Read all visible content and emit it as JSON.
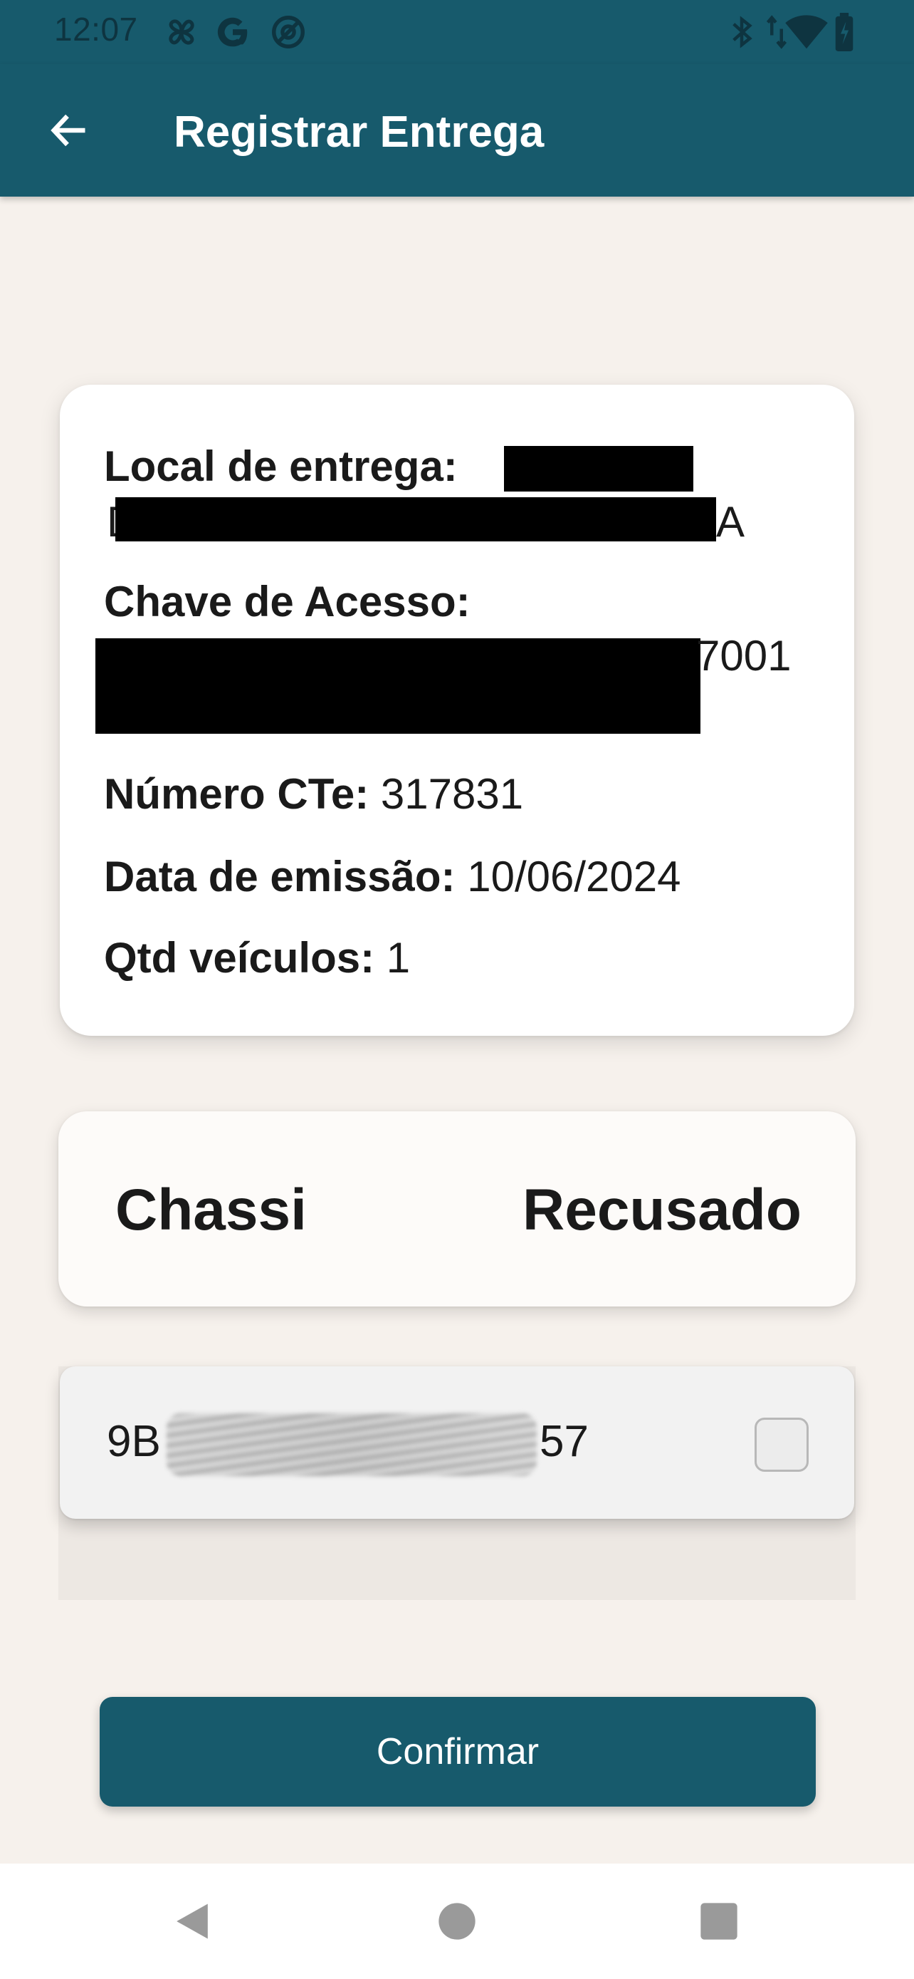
{
  "status_bar": {
    "time": "12:07",
    "left_icons": [
      "fan-icon",
      "google-icon",
      "at-sign-icon"
    ],
    "right_icons": [
      "bluetooth-icon",
      "data-arrows-icon",
      "wifi-icon",
      "battery-icon"
    ]
  },
  "app_bar": {
    "title": "Registrar Entrega",
    "back_icon": "arrow-left-icon"
  },
  "info_card": {
    "local_label": "Local de entrega:",
    "chave_label": "Chave de Acesso:",
    "chave_tail": "7001",
    "numero_label": "Número CTe:",
    "numero_value": "317831",
    "data_label": "Data de emissão:",
    "data_value": "10/06/2024",
    "qtd_label": "Qtd veículos:",
    "qtd_value": "1"
  },
  "table_header": {
    "chassi": "Chassi",
    "recusado": "Recusado"
  },
  "vehicles": [
    {
      "chassi_prefix": "9B",
      "chassi_suffix": "57",
      "recusado": false
    }
  ],
  "actions": {
    "confirm_label": "Confirmar"
  },
  "nav_bar": {
    "icons": [
      "nav-back-icon",
      "nav-home-icon",
      "nav-recents-icon"
    ]
  }
}
